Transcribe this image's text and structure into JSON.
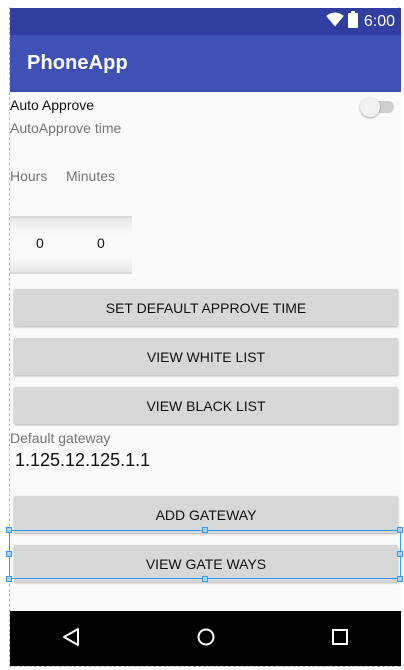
{
  "status_bar": {
    "time": "6:00",
    "icons": [
      "wifi-icon",
      "battery-icon"
    ]
  },
  "app_bar": {
    "title": "PhoneApp",
    "color": "#3f51b5",
    "status_color": "#303f9f"
  },
  "auto_approve": {
    "label": "Auto Approve",
    "switch_on": false
  },
  "approve_time": {
    "label": "AutoApprove time",
    "hours_label": "Hours",
    "minutes_label": "Minutes",
    "hours_value": "0",
    "minutes_value": "0"
  },
  "buttons": {
    "set_default": "SET DEFAULT APPROVE TIME",
    "white_list": "VIEW WHITE LIST",
    "black_list": "VIEW BLACK LIST",
    "add_gateway": "ADD GATEWAY",
    "view_gateways": "VIEW GATE WAYS"
  },
  "gateway": {
    "label": "Default gateway",
    "value": "1.125.12.125.1.1"
  },
  "nav_bar": {
    "items": [
      "back-icon",
      "home-icon",
      "recents-icon"
    ]
  }
}
